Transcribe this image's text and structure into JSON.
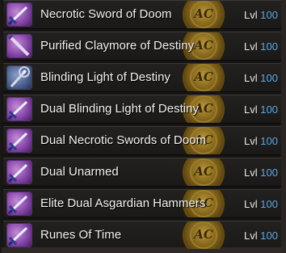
{
  "items": [
    {
      "name": "Necrotic Sword of Doom",
      "level_label": "Lvl",
      "level": "100",
      "emblem": "AC",
      "icon": "sword-icon"
    },
    {
      "name": "Purified Claymore of Destiny",
      "level_label": "Lvl",
      "level": "100",
      "emblem": "AC",
      "icon": "sword-icon"
    },
    {
      "name": "Blinding Light of Destiny",
      "level_label": "Lvl",
      "level": "100",
      "emblem": "AC",
      "icon": "staff-icon"
    },
    {
      "name": "Dual Blinding Light of Destiny",
      "level_label": "Lvl",
      "level": "100",
      "emblem": "AC",
      "icon": "sword-icon"
    },
    {
      "name": "Dual Necrotic Swords of Doom",
      "level_label": "Lvl",
      "level": "100",
      "emblem": "AC",
      "icon": "sword-icon"
    },
    {
      "name": "Dual Unarmed",
      "level_label": "Lvl",
      "level": "100",
      "emblem": "AC",
      "icon": "sword-icon"
    },
    {
      "name": "Elite Dual Asgardian Hammers",
      "level_label": "Lvl",
      "level": "100",
      "emblem": "AC",
      "icon": "sword-icon"
    },
    {
      "name": "Runes Of Time",
      "level_label": "Lvl",
      "level": "100",
      "emblem": "AC",
      "icon": "sword-icon"
    }
  ],
  "colors": {
    "row_bg": "#1b1918",
    "name_text": "#f2f2f2",
    "level_number": "#5aa9e6",
    "emblem_gold": "#b08a2a",
    "icon_purple": "#8244a5"
  }
}
